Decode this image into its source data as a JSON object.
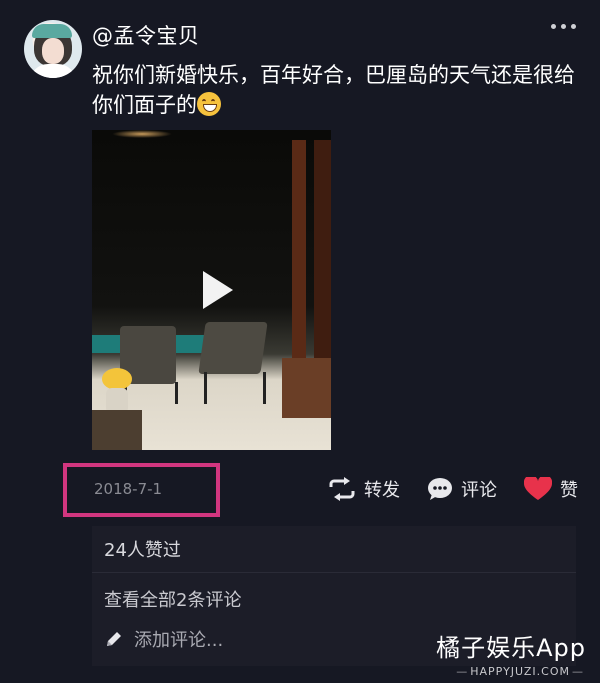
{
  "post": {
    "username": "@孟令宝贝",
    "text": "祝你们新婚快乐，百年好合，巴厘岛的天气还是很给你们面子的",
    "date": "2018-7-1"
  },
  "actions": {
    "repost_label": "转发",
    "comment_label": "评论",
    "like_label": "赞"
  },
  "comments": {
    "likes_summary": "24人赞过",
    "view_all_label": "查看全部2条评论",
    "add_placeholder": "添加评论..."
  },
  "watermark": {
    "title": "橘子娱乐App",
    "url": "HAPPYJUZI.COM"
  },
  "colors": {
    "background": "#161823",
    "highlight_box": "#d2367f",
    "like_heart": "#e8324b"
  },
  "icons": [
    "more-icon",
    "play-icon",
    "repost-icon",
    "comment-icon",
    "heart-icon",
    "pencil-icon"
  ]
}
